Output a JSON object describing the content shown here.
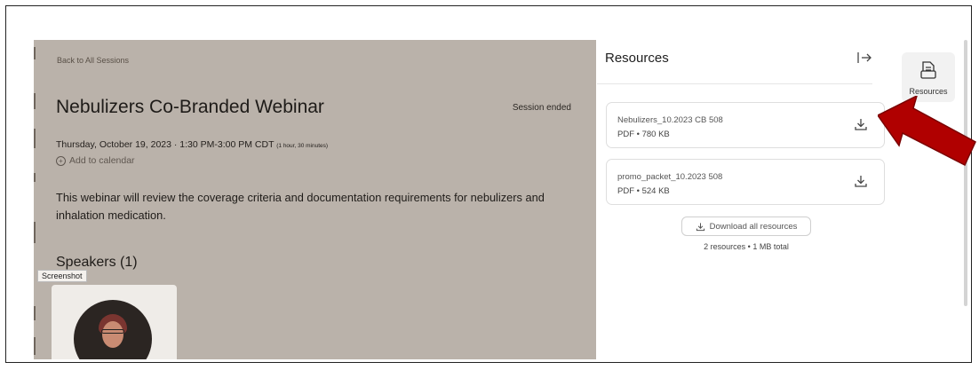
{
  "session": {
    "back_link": "Back to All Sessions",
    "title": "Nebulizers Co-Branded Webinar",
    "status": "Session ended",
    "datetime": "Thursday, October 19, 2023 · 1:30 PM-3:00 PM CDT",
    "duration": "(1 hour, 30 minutes)",
    "add_to_calendar": "Add to calendar",
    "description": "This webinar will review the coverage criteria and documentation requirements for nebulizers and inhalation medication.",
    "speakers_heading": "Speakers (1)",
    "tooltip": "Screenshot",
    "background_color": "#bab2aa"
  },
  "resources": {
    "title": "Resources",
    "files": [
      {
        "name": "Nebulizers_10.2023 CB 508",
        "meta": "PDF • 780 KB",
        "icon": "download-icon"
      },
      {
        "name": "promo_packet_10.2023 508",
        "meta": "PDF • 524 KB",
        "icon": "download-icon"
      }
    ],
    "download_all_label": "Download all resources",
    "summary": "2 resources • 1 MB total"
  },
  "rail": {
    "resources_label": "Resources",
    "icon": "document-icon"
  },
  "annotation": {
    "arrow_color": "#b00000"
  }
}
